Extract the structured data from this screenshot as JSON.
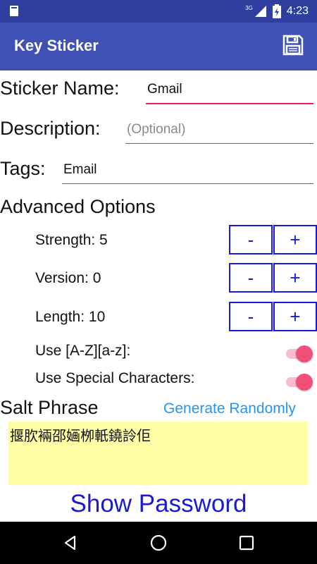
{
  "status_bar": {
    "network": "3G",
    "time": "4:23",
    "icons": [
      "sd-card-icon",
      "signal-icon",
      "battery-icon"
    ]
  },
  "app_bar": {
    "title": "Key Sticker",
    "save_icon": "save-icon"
  },
  "form": {
    "sticker_name": {
      "label": "Sticker Name:",
      "value": "Gmail"
    },
    "description": {
      "label": "Description:",
      "placeholder": "(Optional)"
    },
    "tags": {
      "label": "Tags:",
      "value": "Email"
    }
  },
  "advanced": {
    "heading": "Advanced Options",
    "strength": {
      "label": "Strength: 5"
    },
    "version": {
      "label": "Version: 0"
    },
    "length": {
      "label": "Length: 10"
    },
    "minus_label": "-",
    "plus_label": "+",
    "use_az": {
      "label": "Use [A-Z][a-z]:",
      "checked": true
    },
    "use_special": {
      "label": "Use Special Characters:",
      "checked": true
    }
  },
  "salt": {
    "label": "Salt Phrase",
    "generate_label": "Generate Randomly",
    "value": "揠肷裲邵婳栁軝鐃詅佢"
  },
  "show_password_label": "Show Password",
  "colors": {
    "primary": "#3F51B5",
    "primary_dark": "#303F9F",
    "accent": "#E91E63",
    "button_blue": "#1a1ad6",
    "link_blue": "#2196F3",
    "salt_bg": "#FFFFA8"
  }
}
